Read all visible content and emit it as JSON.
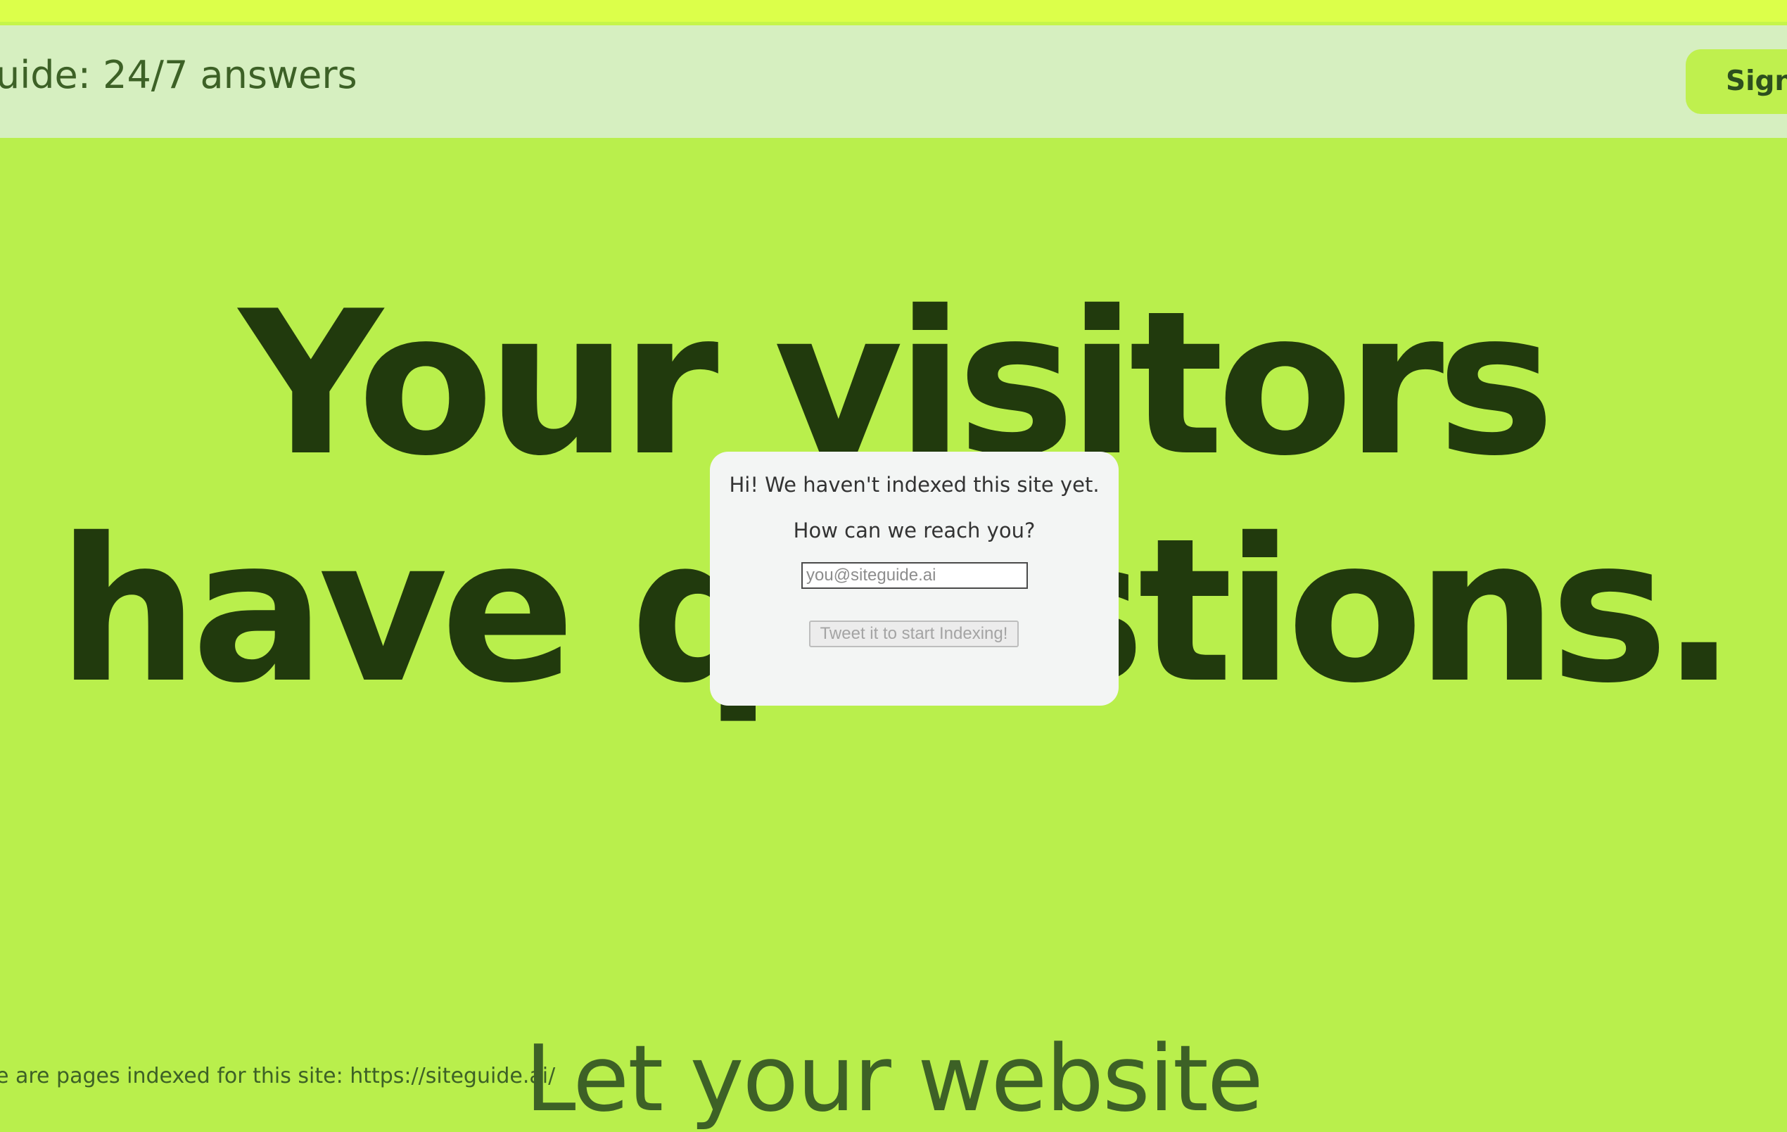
{
  "header": {
    "title": "uide: 24/7 answers",
    "sign_label": "Sign"
  },
  "hero": {
    "line1": "Your visitors",
    "line2": "have questions."
  },
  "subheading": "Let your website",
  "index_status": "e are pages indexed for this site: https://siteguide.ai/",
  "modal": {
    "message": "Hi! We haven't indexed this site yet.",
    "question": "How can we reach you?",
    "email_placeholder": "you@siteguide.ai",
    "email_value": "",
    "tweet_label": "Tweet it to start Indexing!"
  },
  "colors": {
    "page_background": "#b9ef4c",
    "top_strip": "#dcff4a",
    "header_background": "#d6efc0",
    "hero_text": "#213a0d",
    "accent_text": "#3d6126",
    "sign_button": "#bff04e",
    "modal_background": "#f3f5f4"
  }
}
